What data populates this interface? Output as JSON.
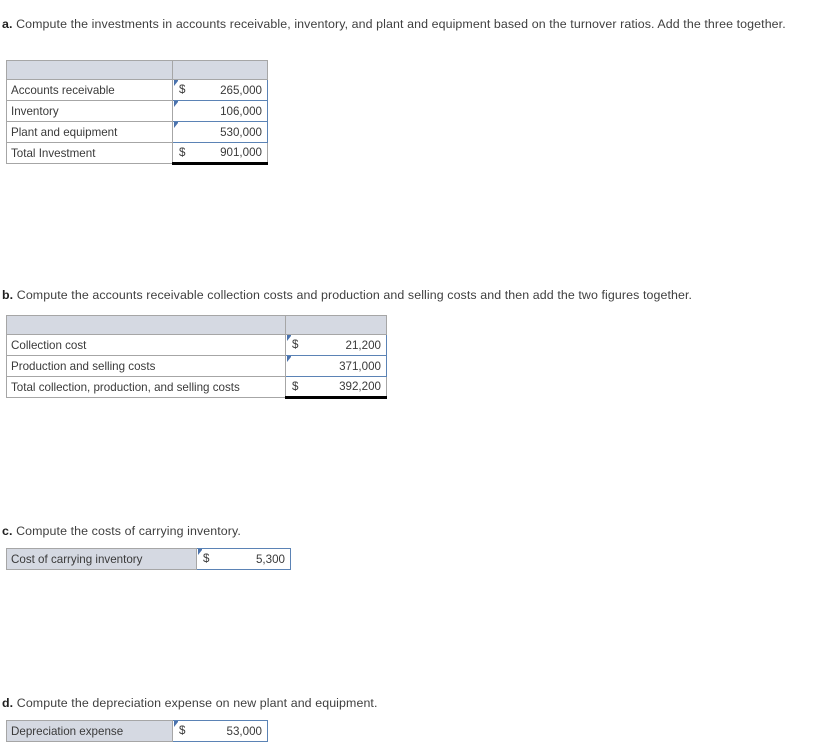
{
  "parts": {
    "a": {
      "label": "a.",
      "text": "Compute the investments in accounts receivable, inventory, and plant and equipment based on the turnover ratios. Add the three together."
    },
    "b": {
      "label": "b.",
      "text": "Compute the accounts receivable collection costs and production and selling costs and then add the two figures together."
    },
    "c": {
      "label": "c.",
      "text": "Compute the costs of carrying inventory."
    },
    "d": {
      "label": "d.",
      "text": "Compute the depreciation expense on new plant and equipment."
    }
  },
  "table_a": {
    "header": {
      "col1": "",
      "col2": ""
    },
    "rows": [
      {
        "label": "Accounts receivable",
        "currency": "$",
        "value": "265,000"
      },
      {
        "label": "Inventory",
        "currency": "",
        "value": "106,000"
      },
      {
        "label": "Plant and equipment",
        "currency": "",
        "value": "530,000"
      },
      {
        "label": "Total Investment",
        "currency": "$",
        "value": "901,000"
      }
    ]
  },
  "table_b": {
    "header": {
      "col1": "",
      "col2": ""
    },
    "rows": [
      {
        "label": "Collection cost",
        "currency": "$",
        "value": "21,200"
      },
      {
        "label": "Production and selling costs",
        "currency": "",
        "value": "371,000"
      },
      {
        "label": "Total collection, production, and selling costs",
        "currency": "$",
        "value": "392,200"
      }
    ]
  },
  "table_c": {
    "rows": [
      {
        "label": "Cost of carrying inventory",
        "currency": "$",
        "value": "5,300"
      }
    ]
  },
  "table_d": {
    "rows": [
      {
        "label": "Depreciation expense",
        "currency": "$",
        "value": "53,000"
      }
    ]
  },
  "colors": {
    "header_fill": "#d5d9e2",
    "input_border": "#5b83b5",
    "grid_line": "#a6a6a6",
    "total_rule": "#000000",
    "text": "#3a3a3a"
  }
}
